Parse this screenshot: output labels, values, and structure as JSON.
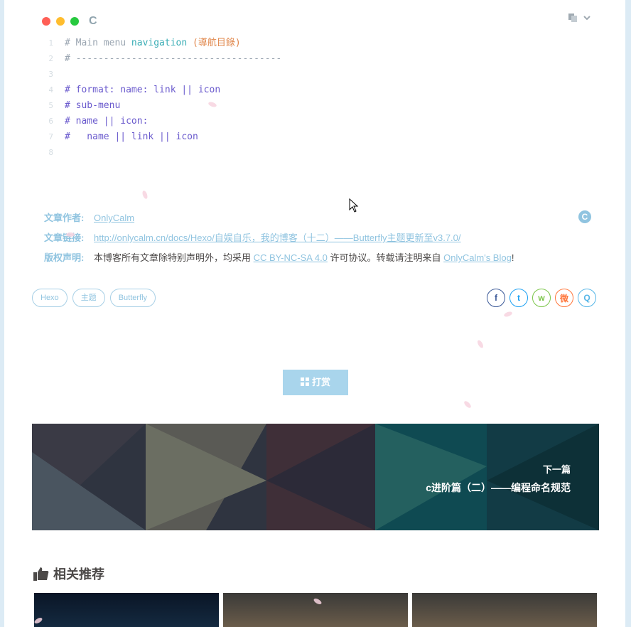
{
  "code": {
    "lang": "C",
    "lines": [
      {
        "num": "1",
        "pre": "# Main menu ",
        "nav": "navigation",
        "zh": " (導航目錄)"
      },
      {
        "num": "2",
        "text": "# -------------------------------------"
      },
      {
        "num": "3",
        "text": ""
      },
      {
        "num": "4",
        "text": "# format: name: link || icon"
      },
      {
        "num": "5",
        "text": "# sub-menu"
      },
      {
        "num": "6",
        "text": "# name || icon:"
      },
      {
        "num": "7",
        "text": "#   name || link || icon"
      },
      {
        "num": "8",
        "text": ""
      }
    ]
  },
  "copyright": {
    "author_label": "文章作者:",
    "author": "OnlyCalm",
    "link_label": "文章链接:",
    "link": "http://onlycalm.cn/docs/Hexo/自娱自乐，我的博客（十二）——Butterfly主题更新至v3.7.0/",
    "notice_label": "版权声明:",
    "notice_pre": "本博客所有文章除特别声明外，均采用 ",
    "license": "CC BY-NC-SA 4.0",
    "notice_mid": " 许可协议。转载请注明来自 ",
    "blog": "OnlyCalm's Blog",
    "notice_end": "!",
    "icon_text": "C"
  },
  "tags": [
    "Hexo",
    "主题",
    "Butterfly"
  ],
  "share": {
    "facebook": "f",
    "twitter": "t",
    "wechat": "w",
    "weibo": "微",
    "qq": "Q"
  },
  "reward": {
    "label": "打赏"
  },
  "next_post": {
    "label": "下一篇",
    "title": "c进阶篇（二）——编程命名规范"
  },
  "related": {
    "title": "相关推荐"
  },
  "colors": {
    "accent": "#90c4e0",
    "reward": "#a9d5ec"
  }
}
